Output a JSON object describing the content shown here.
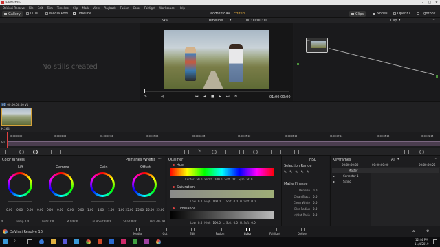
{
  "titlebar": {
    "title": "addtextdav"
  },
  "menubar": {
    "items": [
      "DaVinci Resolve",
      "File",
      "Edit",
      "Trim",
      "Timeline",
      "Clip",
      "Mark",
      "View",
      "Playback",
      "Fusion",
      "Color",
      "Fairlight",
      "Workspace",
      "Help"
    ]
  },
  "toolbar": {
    "gallery": "Gallery",
    "luts": "LUTs",
    "media_pool": "Media Pool",
    "timeline": "Timeline",
    "project": "addtextdav",
    "status": "Edited",
    "clips": "Clips",
    "nodes": "Nodes",
    "openfx": "OpenFX",
    "lightbox": "Lightbox"
  },
  "subbar": {
    "zoom": "24%",
    "timeline_name": "Timeline 1",
    "timecode": "00:00:00:00",
    "clip": "Clip"
  },
  "gallery": {
    "empty": "No stills created"
  },
  "viewer": {
    "timecode": "01:00:00:00"
  },
  "node": {
    "number": "01"
  },
  "clips": {
    "number": "01",
    "timecode": "00:00:00:00",
    "track": "V1",
    "codec": "H.264"
  },
  "timeline": {
    "ticks": [
      "01:00:00:00",
      "01:00:01:02",
      "01:00:02:04",
      "01:00:03:06",
      "01:00:04:08",
      "01:00:05:10",
      "01:00:06:12",
      "01:00:07:14",
      "01:00:08:16",
      "01:00:09:18"
    ],
    "v1": "V1"
  },
  "wheels": {
    "title": "Color Wheels",
    "mode": "Primaries Wheels",
    "labels": [
      "Lift",
      "Gamma",
      "Gain",
      "Offset"
    ],
    "values": [
      [
        "0.00",
        "0.00",
        "0.00",
        "0.00"
      ],
      [
        "0.00",
        "0.00",
        "0.00",
        "0.00"
      ],
      [
        "1.00",
        "1.00",
        "1.00",
        "1.00"
      ],
      [
        "25.00",
        "25.00",
        "25.00",
        "25.00"
      ]
    ],
    "bottom": [
      {
        "k": "Temp",
        "v": "0.0"
      },
      {
        "k": "Tint",
        "v": "0.00"
      },
      {
        "k": "MD",
        "v": "0.00"
      },
      {
        "k": "Col Boost",
        "v": "0.00"
      },
      {
        "k": "Shad",
        "v": "0.00"
      },
      {
        "k": "Hi/L",
        "v": "-45.00"
      }
    ]
  },
  "qualifier": {
    "title": "Qualifier",
    "hue": "Hue",
    "hue_vals": [
      {
        "k": "Center",
        "v": "50.0"
      },
      {
        "k": "Width",
        "v": "100.0"
      },
      {
        "k": "Soft",
        "v": "0.0"
      },
      {
        "k": "Sym",
        "v": "50.0"
      }
    ],
    "sat": "Saturation",
    "sat_vals": [
      {
        "k": "Low",
        "v": "0.0"
      },
      {
        "k": "High",
        "v": "100.0"
      },
      {
        "k": "L. Soft",
        "v": "0.0"
      },
      {
        "k": "H. Soft",
        "v": "0.0"
      }
    ],
    "lum": "Luminance",
    "lum_vals": [
      {
        "k": "Low",
        "v": "0.0"
      },
      {
        "k": "High",
        "v": "100.0"
      },
      {
        "k": "L. Soft",
        "v": "0.0"
      },
      {
        "k": "H. Soft",
        "v": "0.0"
      }
    ]
  },
  "selection": {
    "title": "Selection Range",
    "mode": "HSL",
    "matte": "Matte Finesse",
    "rows": [
      {
        "k": "Denoise",
        "v": "0.0"
      },
      {
        "k": "Clean Black",
        "v": "0.0"
      },
      {
        "k": "Clean White",
        "v": "0.0"
      },
      {
        "k": "Blur Radius",
        "v": "0.0"
      },
      {
        "k": "In/Out Ratio",
        "v": "0.0"
      }
    ]
  },
  "keyframes": {
    "title": "Keyframes",
    "filter": "All",
    "timecode": "00:00:00:00",
    "start": "00:00:00:00",
    "end": "00:00:00:26",
    "rows": [
      "Master",
      "Corrector 1",
      "Sizing"
    ]
  },
  "pages": {
    "brand": "DaVinci Resolve 16",
    "tabs": [
      "Media",
      "Cut",
      "Edit",
      "Fusion",
      "Color",
      "Fairlight",
      "Deliver"
    ],
    "active": "Color"
  },
  "taskbar": {
    "time": "12:44 PM",
    "date": "11/4/2019"
  }
}
